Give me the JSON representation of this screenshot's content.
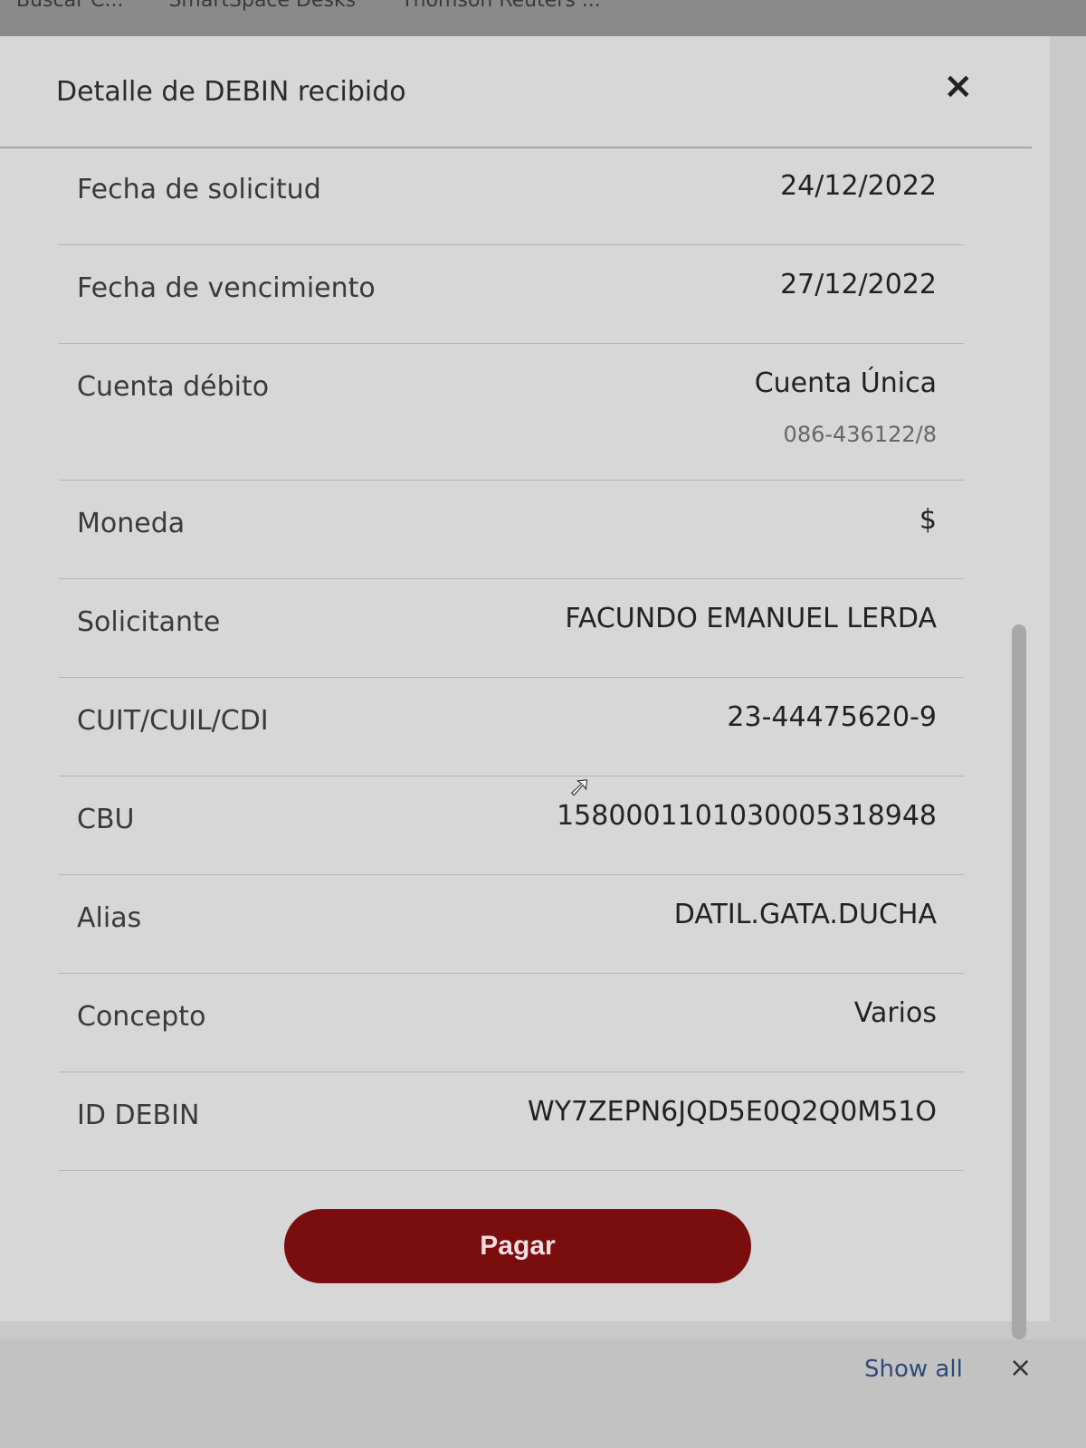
{
  "bookmarks": [
    "Buscar C...",
    "SmartSpace Desks",
    "Thomson Reuters ..."
  ],
  "modal": {
    "title": "Detalle de DEBIN recibido",
    "rows": [
      {
        "label": "Fecha de solicitud",
        "value": "24/12/2022"
      },
      {
        "label": "Fecha de vencimiento",
        "value": "27/12/2022"
      },
      {
        "label": "Cuenta débito",
        "value": "Cuenta Única",
        "sub": "086-436122/8"
      },
      {
        "label": "Moneda",
        "value": "$"
      },
      {
        "label": "Solicitante",
        "value": "FACUNDO EMANUEL LERDA"
      },
      {
        "label": "CUIT/CUIL/CDI",
        "value": "23-44475620-9"
      },
      {
        "label": "CBU",
        "value": "1580001101030005318948"
      },
      {
        "label": "Alias",
        "value": "DATIL.GATA.DUCHA"
      },
      {
        "label": "Concepto",
        "value": "Varios"
      },
      {
        "label": "ID DEBIN",
        "value": "WY7ZEPN6JQD5E0Q2Q0M51O"
      }
    ],
    "pay_label": "Pagar"
  },
  "downloads": {
    "show_all": "Show all",
    "close": "×"
  },
  "close_symbol": "×"
}
